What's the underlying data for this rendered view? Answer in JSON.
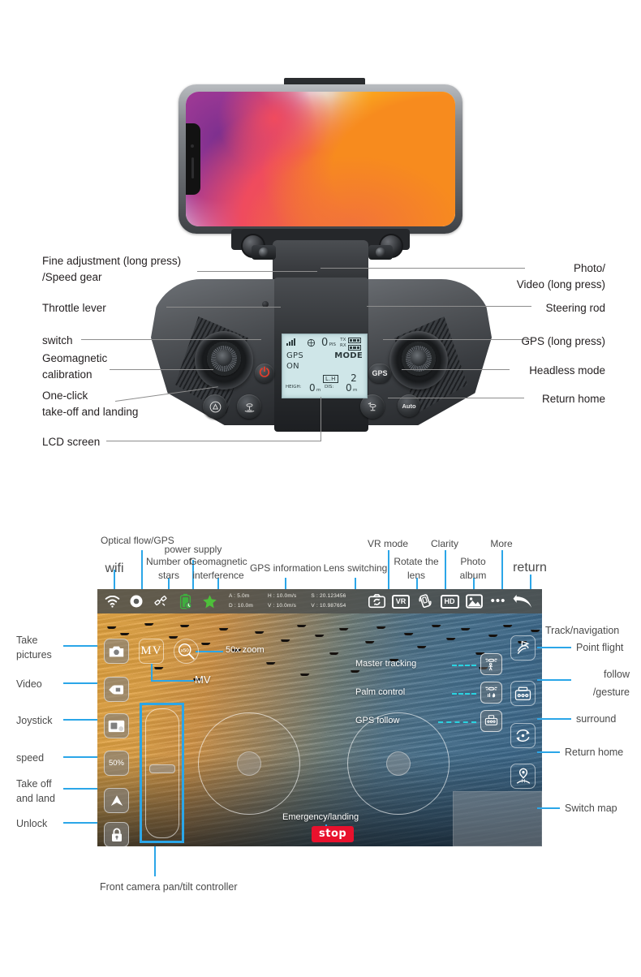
{
  "controller_section": {
    "left_labels": [
      {
        "id": "fine-adjustment",
        "text": "Fine adjustment (long press)\n/Speed gear"
      },
      {
        "id": "throttle-lever",
        "text": "Throttle lever"
      },
      {
        "id": "switch",
        "text": "switch"
      },
      {
        "id": "geomagnetic-calibration",
        "text": "Geomagnetic\ncalibration"
      },
      {
        "id": "one-click-takeoff",
        "text": "One-click\ntake-off and landing"
      },
      {
        "id": "lcd-screen",
        "text": "LCD screen"
      }
    ],
    "right_labels": [
      {
        "id": "photo-video",
        "text": "Photo/\nVideo (long press)"
      },
      {
        "id": "steering-rod",
        "text": "Steering rod"
      },
      {
        "id": "gps-long-press",
        "text": "GPS (long press)"
      },
      {
        "id": "headless-mode",
        "text": "Headless mode"
      },
      {
        "id": "return-home",
        "text": "Return home"
      }
    ],
    "buttons": {
      "power": "power-icon",
      "calibration": "triangle-circle-icon",
      "takeoff_landing": "drone-landing-icon",
      "gps": "GPS",
      "auto": "Auto",
      "return_home": "drone-return-icon"
    },
    "lcd": {
      "signal": "signal-bars",
      "satellite_icon": "satellite-icon",
      "pis_value": "0",
      "pis_unit": "PIS",
      "tx_label": "TX",
      "rx_label": "RX",
      "gps_label": "GPS",
      "gps_state": "ON",
      "mode_label": "MODE",
      "lh_label": "L.H",
      "mode_value": "2",
      "height_label": "HEIGH:",
      "height_value": "0",
      "height_unit": "m",
      "distance_label": "DIS:",
      "distance_value": "0",
      "distance_unit": "m"
    }
  },
  "app_section": {
    "top_callouts": [
      {
        "id": "wifi",
        "text": "wifi"
      },
      {
        "id": "optical-flow-gps",
        "text": "Optical flow/GPS"
      },
      {
        "id": "number-of-stars",
        "text": "Number of\nstars"
      },
      {
        "id": "power-supply",
        "text": "power supply"
      },
      {
        "id": "geomagnetic-interference",
        "text": "Geomagnetic\ninterference"
      },
      {
        "id": "gps-information",
        "text": "GPS information"
      },
      {
        "id": "lens-switching",
        "text": "Lens switching"
      },
      {
        "id": "vr-mode",
        "text": "VR mode"
      },
      {
        "id": "rotate-the-lens",
        "text": "Rotate the\nlens"
      },
      {
        "id": "clarity",
        "text": "Clarity"
      },
      {
        "id": "photo-album",
        "text": "Photo\nalbum"
      },
      {
        "id": "more",
        "text": "More"
      },
      {
        "id": "return",
        "text": "return"
      }
    ],
    "left_callouts": [
      {
        "id": "take-pictures",
        "text": "Take\npictures"
      },
      {
        "id": "video",
        "text": "Video"
      },
      {
        "id": "joystick",
        "text": "Joystick"
      },
      {
        "id": "speed",
        "text": "speed"
      },
      {
        "id": "take-off-land",
        "text": "Take off\nand land"
      },
      {
        "id": "unlock",
        "text": "Unlock"
      }
    ],
    "right_callouts": [
      {
        "id": "track-navigation",
        "text": "Track/navigation"
      },
      {
        "id": "point-flight",
        "text": "Point flight"
      },
      {
        "id": "follow-gesture-1",
        "text": "follow"
      },
      {
        "id": "follow-gesture-2",
        "text": "/gesture"
      },
      {
        "id": "surround",
        "text": "surround"
      },
      {
        "id": "return-home",
        "text": "Return home"
      },
      {
        "id": "switch-map",
        "text": "Switch map"
      }
    ],
    "bottom_callout": {
      "id": "front-camera-pan-tilt",
      "text": "Front camera pan/tilt controller"
    },
    "inside_callouts": [
      {
        "id": "zoom-50x",
        "text": "50x zoom"
      },
      {
        "id": "mv",
        "text": "MV"
      },
      {
        "id": "master-tracking",
        "text": "Master tracking"
      },
      {
        "id": "palm-control",
        "text": "Palm control"
      },
      {
        "id": "gps-follow",
        "text": "GPS follow"
      }
    ],
    "topbar": {
      "icons": [
        "wifi-icon",
        "optical-flow-icon",
        "satellite-icon",
        "battery-icon",
        "geomagnetic-star-icon"
      ],
      "telemetry": {
        "altitude": "A : 5.0m",
        "distance": "D : 10.0m",
        "h_speed": "H : 10.0m/s",
        "v_speed": "V : 10.0m/s",
        "gps_s": "S : 20.123456",
        "gps_v": "V : 10.987654"
      },
      "right_icons": [
        {
          "id": "lens-switch-icon",
          "label": ""
        },
        {
          "id": "vr-icon",
          "label": "VR"
        },
        {
          "id": "rotate-lens-icon",
          "label": ""
        },
        {
          "id": "hd-icon",
          "label": "HD"
        },
        {
          "id": "photo-album-icon",
          "label": ""
        },
        {
          "id": "more-icon",
          "label": "•••"
        },
        {
          "id": "return-icon",
          "label": ""
        }
      ]
    },
    "left_toolbar": [
      {
        "id": "take-picture-button",
        "icon": "camera-icon",
        "label": ""
      },
      {
        "id": "mv-button",
        "icon": "text",
        "label": "MV"
      },
      {
        "id": "zoom-button",
        "icon": "zoom-icon",
        "label": "x50"
      },
      {
        "id": "video-button",
        "icon": "video-icon",
        "label": ""
      },
      {
        "id": "joystick-button",
        "icon": "joystick-icon",
        "label": ""
      },
      {
        "id": "speed-button",
        "icon": "text",
        "label": "50%"
      },
      {
        "id": "takeoff-button",
        "icon": "arrow-up-icon",
        "label": ""
      },
      {
        "id": "unlock-button",
        "icon": "lock-icon",
        "label": ""
      }
    ],
    "mid_toolbar": [
      {
        "id": "master-tracking-button",
        "icon": "tracking-icon"
      },
      {
        "id": "palm-control-button",
        "icon": "palm-icon"
      },
      {
        "id": "gps-follow-button",
        "icon": "gps-follow-icon"
      }
    ],
    "right_toolbar": [
      {
        "id": "point-flight-button",
        "icon": "waypoint-icon"
      },
      {
        "id": "follow-button",
        "icon": "follow-icon"
      },
      {
        "id": "surround-button",
        "icon": "orbit-icon"
      },
      {
        "id": "return-home-button",
        "icon": "home-pin-icon"
      }
    ],
    "overlay": {
      "emergency_text": "Emergency/landing",
      "stop_label": "stop"
    }
  },
  "colors": {
    "accent_blue": "#2ba6e8",
    "dash_cyan": "#2ad2e0",
    "stop_red": "#e8112d",
    "label_gray": "#231f20",
    "leader_gray": "#8d8d8d"
  }
}
